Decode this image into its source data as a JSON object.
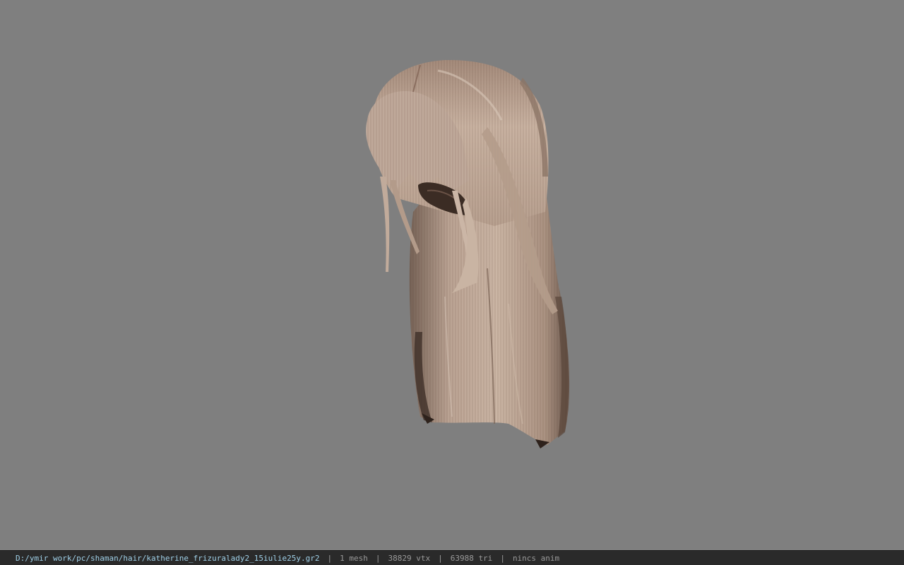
{
  "viewer": {
    "background_color": "#7f7f7f",
    "model_icon": "hair-model-icon"
  },
  "statusbar": {
    "file_path": "D:/ymir work/pc/shaman/hair/katherine_frizuralady2_15iulie25y.gr2",
    "separator": "|",
    "mesh_count": "1 mesh",
    "vertex_count": "38829 vtx",
    "triangle_count": "63988 tri",
    "anim_status": "nincs anim",
    "path_color": "#9fd0e8",
    "text_color": "#9a9a9a"
  }
}
